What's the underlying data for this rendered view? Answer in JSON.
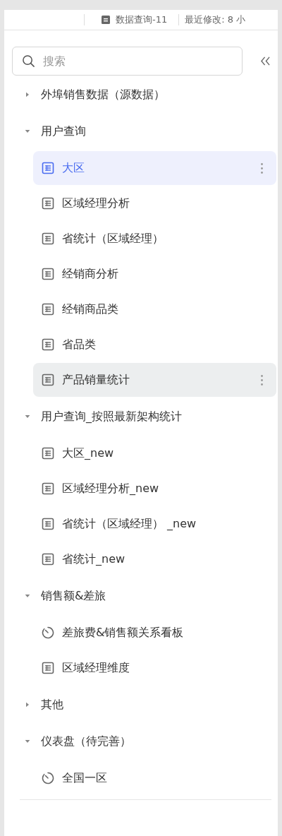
{
  "header": {
    "document_title": "数据查询-11",
    "modified": "最近修改: 8 小"
  },
  "search": {
    "placeholder": "搜索"
  },
  "tree": [
    {
      "label": "外埠销售数据（源数据）",
      "expanded": false
    },
    {
      "label": "用户查询",
      "expanded": true,
      "children": [
        {
          "label": "大区",
          "kind": "table",
          "selected": true,
          "hovered": false
        },
        {
          "label": "区域经理分析",
          "kind": "table",
          "selected": false,
          "hovered": false
        },
        {
          "label": "省统计（区域经理）",
          "kind": "table",
          "selected": false,
          "hovered": false
        },
        {
          "label": "经销商分析",
          "kind": "table",
          "selected": false,
          "hovered": false
        },
        {
          "label": "经销商品类",
          "kind": "table",
          "selected": false,
          "hovered": false
        },
        {
          "label": "省品类",
          "kind": "table",
          "selected": false,
          "hovered": false
        },
        {
          "label": "产品销量统计",
          "kind": "table",
          "selected": false,
          "hovered": true
        }
      ]
    },
    {
      "label": "用户查询_按照最新架构统计",
      "expanded": true,
      "children": [
        {
          "label": "大区_new",
          "kind": "table",
          "selected": false,
          "hovered": false
        },
        {
          "label": "区域经理分析_new",
          "kind": "table",
          "selected": false,
          "hovered": false
        },
        {
          "label": "省统计（区域经理） _new",
          "kind": "table",
          "selected": false,
          "hovered": false
        },
        {
          "label": "省统计_new",
          "kind": "table",
          "selected": false,
          "hovered": false
        }
      ]
    },
    {
      "label": "销售额&差旅",
      "expanded": true,
      "children": [
        {
          "label": "差旅费&销售额关系看板",
          "kind": "dashboard",
          "selected": false,
          "hovered": false
        },
        {
          "label": "区域经理维度",
          "kind": "table",
          "selected": false,
          "hovered": false
        }
      ]
    },
    {
      "label": "其他",
      "expanded": false
    },
    {
      "label": "仪表盘（待完善）",
      "expanded": true,
      "children": [
        {
          "label": "全国一区",
          "kind": "dashboard",
          "selected": false,
          "hovered": false
        }
      ]
    }
  ]
}
